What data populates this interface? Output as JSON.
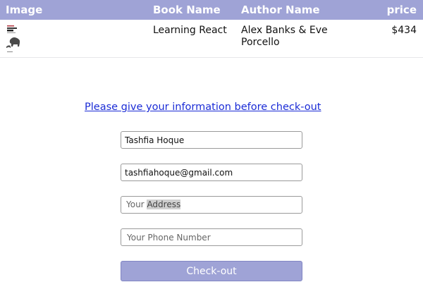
{
  "table": {
    "headers": {
      "image": "Image",
      "book": "Book Name",
      "author": "Author Name",
      "price": "price"
    },
    "rows": [
      {
        "cover_icon": "book-cover-learning-react-icon",
        "book_name": "Learning React",
        "author": "Alex Banks & Eve Porcello",
        "price": "$434"
      }
    ]
  },
  "form": {
    "prompt": "Please give your information before check-out",
    "name_value": "Tashfia Hoque",
    "email_value": "tashfiahoque@gmail.com",
    "address_placeholder_before": "Your ",
    "address_placeholder_selected": "Address",
    "address_placeholder": "Your Address",
    "phone_placeholder": "Your Phone Number",
    "checkout_label": "Check-out"
  },
  "colors": {
    "accent": "#9fa3d6",
    "link": "#1a2bd6"
  }
}
